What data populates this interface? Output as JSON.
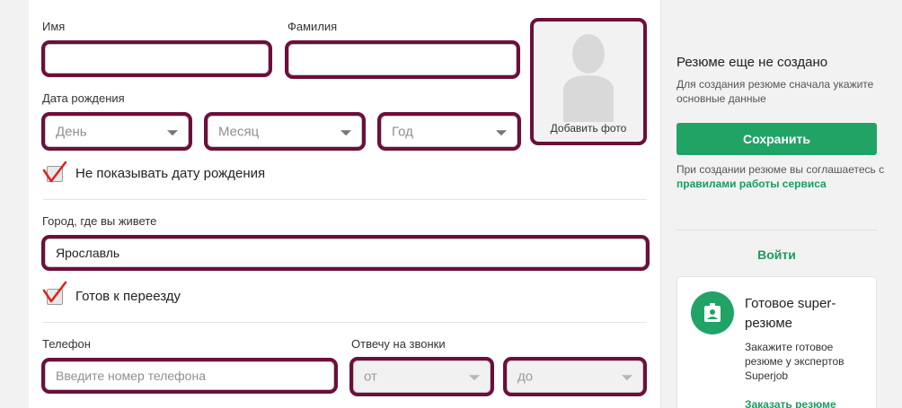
{
  "form": {
    "first_name": {
      "label": "Имя",
      "value": ""
    },
    "last_name": {
      "label": "Фамилия",
      "value": ""
    },
    "birth_date": {
      "label": "Дата рождения",
      "day_placeholder": "День",
      "month_placeholder": "Месяц",
      "year_placeholder": "Год"
    },
    "hide_birth_date": {
      "label": "Не показывать дату рождения",
      "checked": true
    },
    "photo": {
      "label": "Добавить фото"
    },
    "city": {
      "label": "Город, где вы живете",
      "value": "Ярославль"
    },
    "relocate": {
      "label": "Готов к переезду",
      "checked": true
    },
    "phone": {
      "label": "Телефон",
      "placeholder": "Введите номер телефона"
    },
    "call_time": {
      "label": "Отвечу на звонки",
      "from_placeholder": "от",
      "to_placeholder": "до"
    }
  },
  "sidebar": {
    "title": "Резюме еще не создано",
    "subtitle": "Для создания резюме сначала укажите основные данные",
    "save_label": "Сохранить",
    "terms_prefix": "При создании резюме вы соглашаетесь с",
    "terms_link": "правилами работы сервиса",
    "login_label": "Войти",
    "promo": {
      "title": "Готовое super-резюме",
      "text": "Закажите готовое резюме у экспертов Superjob",
      "link": "Заказать резюме"
    }
  },
  "colors": {
    "highlight_border": "#6d0f3a",
    "brand_green": "#21a366",
    "check_mark": "#e0201b"
  },
  "icons": {
    "dropdown": "chevron-down-icon",
    "avatar": "avatar-silhouette-icon",
    "promo": "resume-badge-icon",
    "check": "check-icon"
  }
}
